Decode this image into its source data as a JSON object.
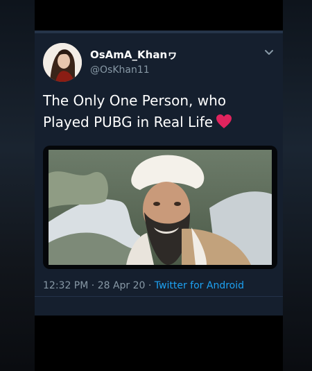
{
  "tweet": {
    "display_name": "OsAmA_Khanヮ",
    "handle": "@OsKhan11",
    "text": "The Only One Person, who Played PUBG in Real Life",
    "time": "12:32 PM",
    "separator": "·",
    "date": "28 Apr 20",
    "source": "Twitter for Android"
  },
  "icons": {
    "menu": "chevron-down-icon",
    "emoji": "red-heart-icon"
  },
  "colors": {
    "background": "#151f2e",
    "text": "#ffffff",
    "muted": "#8899a6",
    "link": "#1da1f2",
    "heart": "#e0245e"
  }
}
